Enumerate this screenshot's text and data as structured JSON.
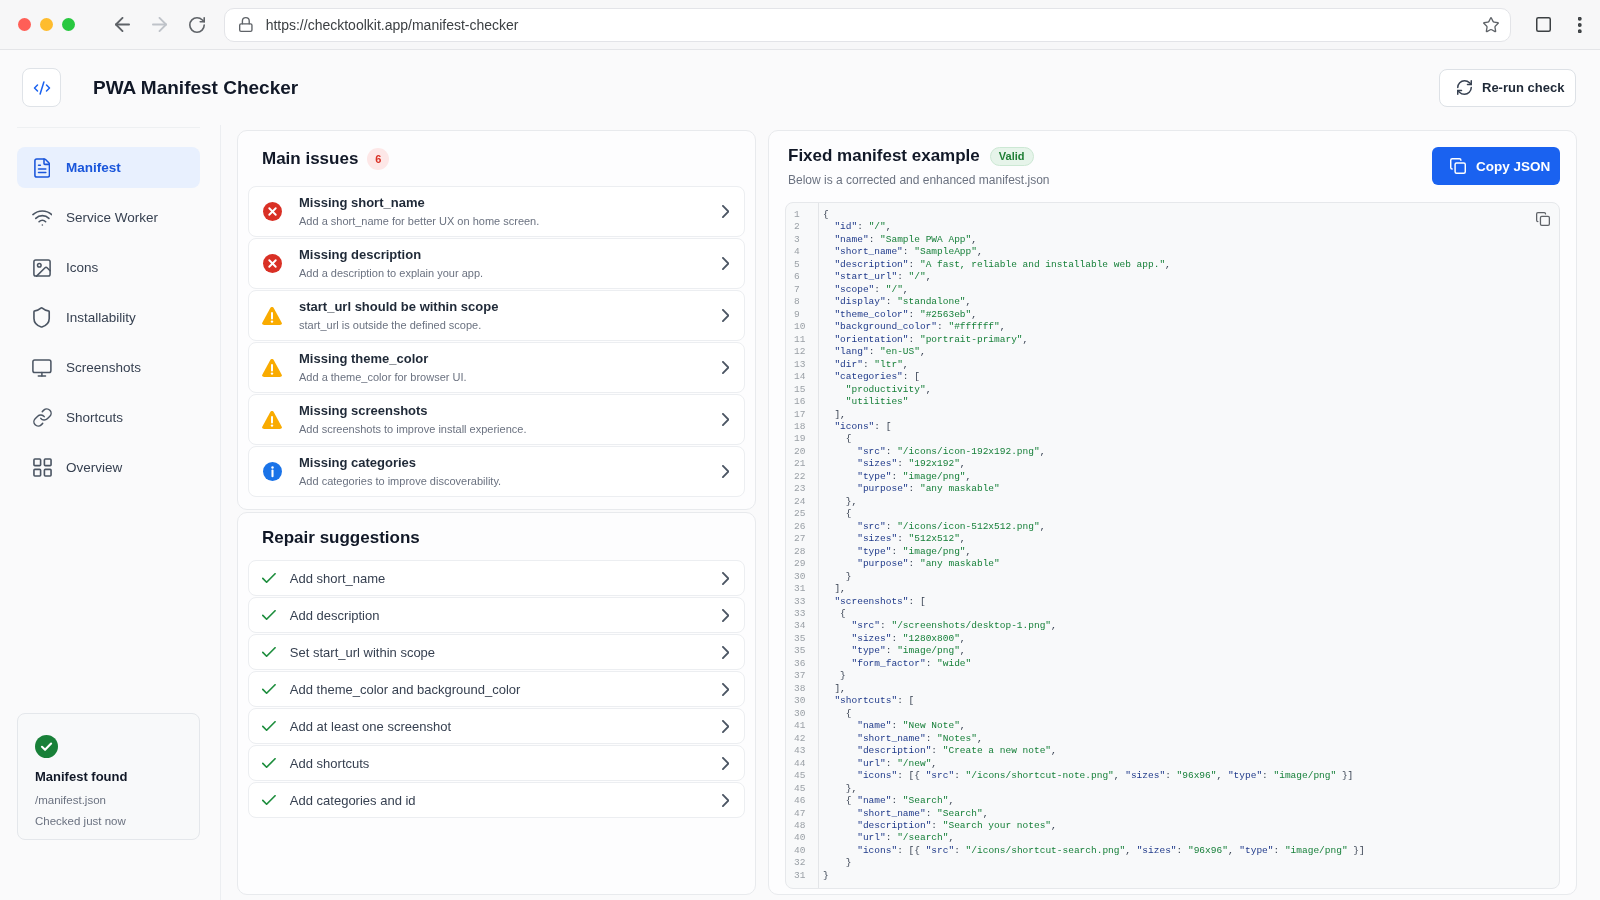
{
  "browser": {
    "url": "https://checktoolkit.app/manifest-checker",
    "back": {
      "disabled": false
    },
    "forward": {
      "disabled": true
    }
  },
  "header": {
    "title": "PWA Manifest Checker",
    "rerun_button": "Re-run check"
  },
  "sidebar": {
    "items": [
      {
        "label": "Manifest",
        "selected": true
      },
      {
        "label": "Service Worker",
        "selected": false
      },
      {
        "label": "Icons",
        "selected": false
      },
      {
        "label": "Installability",
        "selected": false
      },
      {
        "label": "Screenshots",
        "selected": false
      },
      {
        "label": "Shortcuts",
        "selected": false
      },
      {
        "label": "Overview",
        "selected": false
      }
    ],
    "status_card": {
      "title": "Manifest found",
      "path": "/manifest.json",
      "checked_time": "Checked just now"
    }
  },
  "main_issues": {
    "title": "Main issues",
    "count": "6",
    "items": [
      {
        "kind": "error",
        "title": "Missing short_name",
        "description": "Add a short_name for better UX on home screen."
      },
      {
        "kind": "error",
        "title": "Missing description",
        "description": "Add a description to explain your app."
      },
      {
        "kind": "warning",
        "title": "start_url should be within scope",
        "description": "start_url is outside the defined scope."
      },
      {
        "kind": "warning",
        "title": "Missing theme_color",
        "description": "Add a theme_color for browser UI."
      },
      {
        "kind": "warning",
        "title": "Missing screenshots",
        "description": "Add screenshots to improve install experience."
      },
      {
        "kind": "info",
        "title": "Missing categories",
        "description": "Add categories to improve discoverability."
      }
    ]
  },
  "repair_suggestions": {
    "title": "Repair suggestions",
    "items": [
      "Add short_name",
      "Add description",
      "Set start_url within scope",
      "Add theme_color and background_color",
      "Add at least one screenshot",
      "Add shortcuts",
      "Add categories and id"
    ]
  },
  "fixed_manifest": {
    "title": "Fixed manifest example",
    "badge": "Valid",
    "subtitle": "Below is a corrected and enhanced manifest.json",
    "copy_button": "Copy JSON",
    "lines": [
      {
        "number": "1",
        "code": "{"
      },
      {
        "number": "2",
        "code": "  \"id\": \"/\","
      },
      {
        "number": "3",
        "code": "  \"name\": \"Sample PWA App\","
      },
      {
        "number": "4",
        "code": "  \"short_name\": \"SampleApp\","
      },
      {
        "number": "5",
        "code": "  \"description\": \"A fast, reliable and installable web app.\","
      },
      {
        "number": "6",
        "code": "  \"start_url\": \"/\","
      },
      {
        "number": "7",
        "code": "  \"scope\": \"/\","
      },
      {
        "number": "8",
        "code": "  \"display\": \"standalone\","
      },
      {
        "number": "9",
        "code": "  \"theme_color\": \"#2563eb\","
      },
      {
        "number": "10",
        "code": "  \"background_color\": \"#ffffff\","
      },
      {
        "number": "11",
        "code": "  \"orientation\": \"portrait-primary\","
      },
      {
        "number": "12",
        "code": "  \"lang\": \"en-US\","
      },
      {
        "number": "13",
        "code": "  \"dir\": \"ltr\","
      },
      {
        "number": "14",
        "code": "  \"categories\": ["
      },
      {
        "number": "15",
        "code": "    \"productivity\","
      },
      {
        "number": "16",
        "code": "    \"utilities\""
      },
      {
        "number": "17",
        "code": "  ],"
      },
      {
        "number": "18",
        "code": "  \"icons\": ["
      },
      {
        "number": "19",
        "code": "    {"
      },
      {
        "number": "20",
        "code": "      \"src\": \"/icons/icon-192x192.png\","
      },
      {
        "number": "21",
        "code": "      \"sizes\": \"192x192\","
      },
      {
        "number": "22",
        "code": "      \"type\": \"image/png\","
      },
      {
        "number": "23",
        "code": "      \"purpose\": \"any maskable\""
      },
      {
        "number": "24",
        "code": "    },"
      },
      {
        "number": "25",
        "code": "    {"
      },
      {
        "number": "26",
        "code": "      \"src\": \"/icons/icon-512x512.png\","
      },
      {
        "number": "27",
        "code": "      \"sizes\": \"512x512\","
      },
      {
        "number": "28",
        "code": "      \"type\": \"image/png\","
      },
      {
        "number": "29",
        "code": "      \"purpose\": \"any maskable\""
      },
      {
        "number": "30",
        "code": "    }"
      },
      {
        "number": "31",
        "code": "  ],"
      },
      {
        "number": "33",
        "code": "  \"screenshots\": ["
      },
      {
        "number": "33",
        "code": "   {"
      },
      {
        "number": "34",
        "code": "     \"src\": \"/screenshots/desktop-1.png\","
      },
      {
        "number": "35",
        "code": "     \"sizes\": \"1280x800\","
      },
      {
        "number": "35",
        "code": "     \"type\": \"image/png\","
      },
      {
        "number": "36",
        "code": "     \"form_factor\": \"wide\""
      },
      {
        "number": "37",
        "code": "   }"
      },
      {
        "number": "38",
        "code": "  ],"
      },
      {
        "number": "30",
        "code": "  \"shortcuts\": ["
      },
      {
        "number": "30",
        "code": "    {"
      },
      {
        "number": "41",
        "code": "      \"name\": \"New Note\","
      },
      {
        "number": "42",
        "code": "      \"short_name\": \"Notes\","
      },
      {
        "number": "43",
        "code": "      \"description\": \"Create a new note\","
      },
      {
        "number": "44",
        "code": "      \"url\": \"/new\","
      },
      {
        "number": "45",
        "code": "      \"icons\": [{ \"src\": \"/icons/shortcut-note.png\", \"sizes\": \"96x96\", \"type\": \"image/png\" }]"
      },
      {
        "number": "45",
        "code": "    },"
      },
      {
        "number": "46",
        "code": "    { \"name\": \"Search\","
      },
      {
        "number": "47",
        "code": "      \"short_name\": \"Search\","
      },
      {
        "number": "48",
        "code": "      \"description\": \"Search your notes\","
      },
      {
        "number": "40",
        "code": "      \"url\": \"/search\","
      },
      {
        "number": "40",
        "code": "      \"icons\": [{ \"src\": \"/icons/shortcut-search.png\", \"sizes\": \"96x96\", \"type\": \"image/png\" }]"
      },
      {
        "number": "32",
        "code": "    }"
      },
      {
        "number": "31",
        "code": "}"
      }
    ]
  }
}
